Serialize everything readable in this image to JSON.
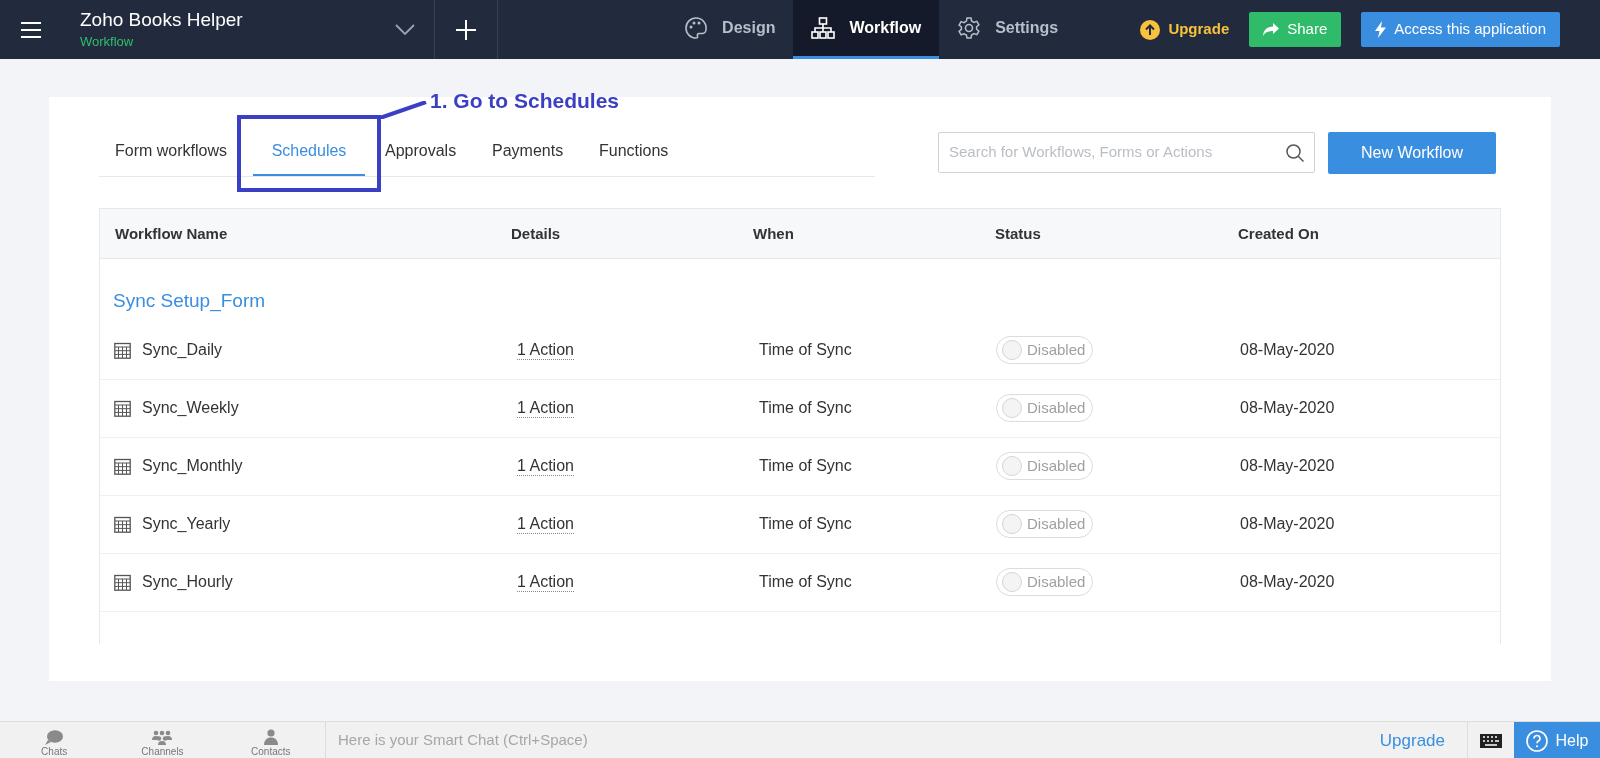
{
  "app": {
    "title": "Zoho Books Helper",
    "subtitle": "Workflow"
  },
  "nav": [
    {
      "label": "Design",
      "selected": false
    },
    {
      "label": "Workflow",
      "selected": true
    },
    {
      "label": "Settings",
      "selected": false
    }
  ],
  "header_actions": {
    "upgrade": "Upgrade",
    "share": "Share",
    "access": "Access this application"
  },
  "tabs": [
    {
      "label": "Form workflows",
      "selected": false
    },
    {
      "label": "Schedules",
      "selected": true
    },
    {
      "label": "Approvals",
      "selected": false
    },
    {
      "label": "Payments",
      "selected": false
    },
    {
      "label": "Functions",
      "selected": false
    }
  ],
  "annotation": "1. Go to Schedules",
  "search": {
    "placeholder": "Search for Workflows, Forms or Actions"
  },
  "new_button": "New Workflow",
  "table": {
    "columns": [
      "Workflow Name",
      "Details",
      "When",
      "Status",
      "Created On"
    ],
    "group": "Sync Setup_Form",
    "rows": [
      {
        "name": "Sync_Daily",
        "details": "1 Action",
        "when": "Time of Sync",
        "status": "Disabled",
        "on": false,
        "created": "08-May-2020"
      },
      {
        "name": "Sync_Weekly",
        "details": "1 Action",
        "when": "Time of Sync",
        "status": "Disabled",
        "on": false,
        "created": "08-May-2020"
      },
      {
        "name": "Sync_Monthly",
        "details": "1 Action",
        "when": "Time of Sync",
        "status": "Disabled",
        "on": false,
        "created": "08-May-2020"
      },
      {
        "name": "Sync_Yearly",
        "details": "1 Action",
        "when": "Time of Sync",
        "status": "Disabled",
        "on": false,
        "created": "08-May-2020"
      },
      {
        "name": "Sync_Hourly",
        "details": "1 Action",
        "when": "Time of Sync",
        "status": "Disabled",
        "on": false,
        "created": "08-May-2020"
      }
    ]
  },
  "bottom_bar": {
    "tabs": [
      "Chats",
      "Channels",
      "Contacts"
    ],
    "chat_placeholder": "Here is your Smart Chat (Ctrl+Space)",
    "upgrade": "Upgrade",
    "help": "Help"
  }
}
